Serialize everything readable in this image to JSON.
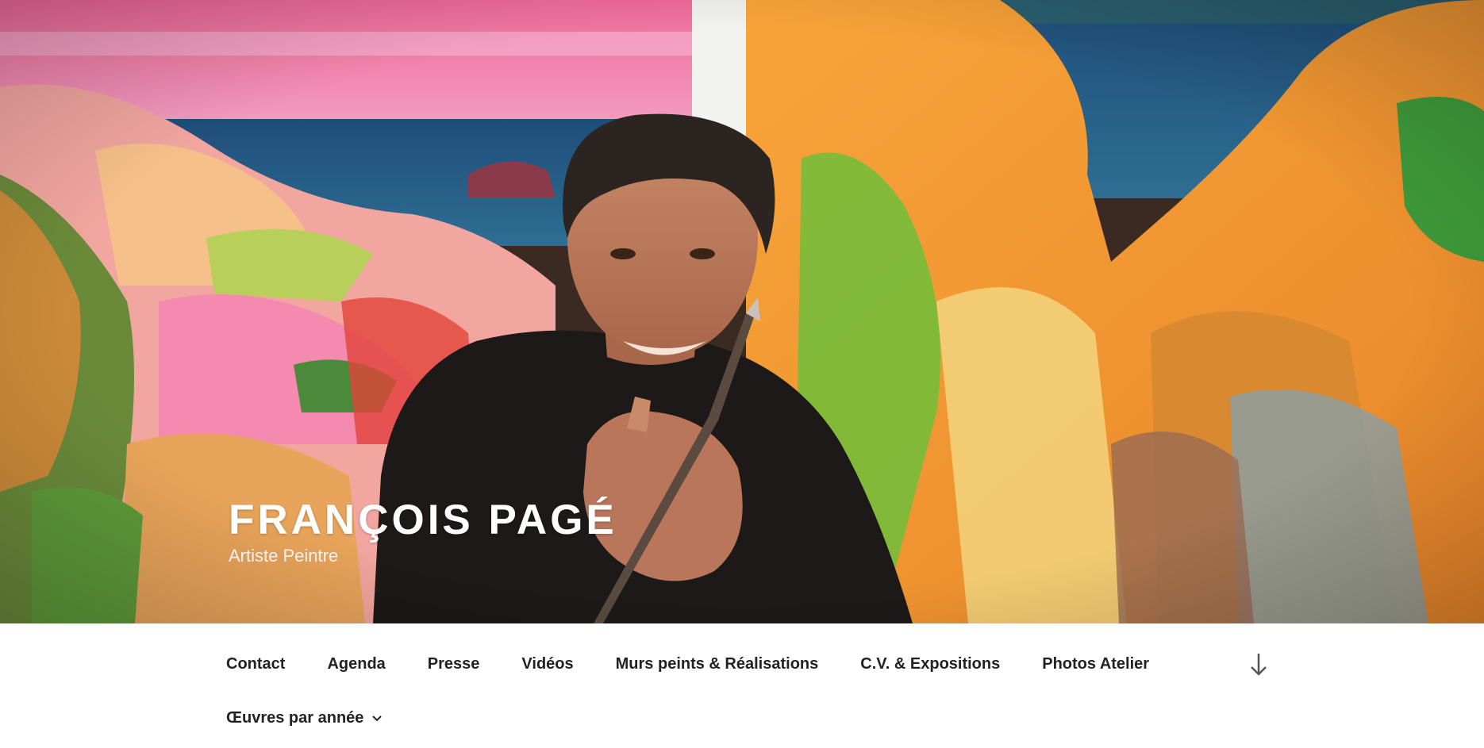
{
  "site": {
    "title": "FRANÇOIS PAGÉ",
    "description": "Artiste Peintre"
  },
  "hero": {
    "image": "painter-portrait-in-front-of-colorful-coastal-painting"
  },
  "nav": {
    "items": [
      {
        "label": "Contact"
      },
      {
        "label": "Agenda"
      },
      {
        "label": "Presse"
      },
      {
        "label": "Vidéos"
      },
      {
        "label": "Murs peints & Réalisations"
      },
      {
        "label": "C.V. & Expositions"
      },
      {
        "label": "Photos Atelier"
      },
      {
        "label": "Œuvres par année",
        "has_submenu": true
      }
    ],
    "scroll_icon": "arrow-down-icon",
    "submenu_icon": "chevron-down-icon"
  },
  "colors": {
    "nav_text": "#222222",
    "title_text": "#ffffff",
    "background": "#ffffff"
  }
}
